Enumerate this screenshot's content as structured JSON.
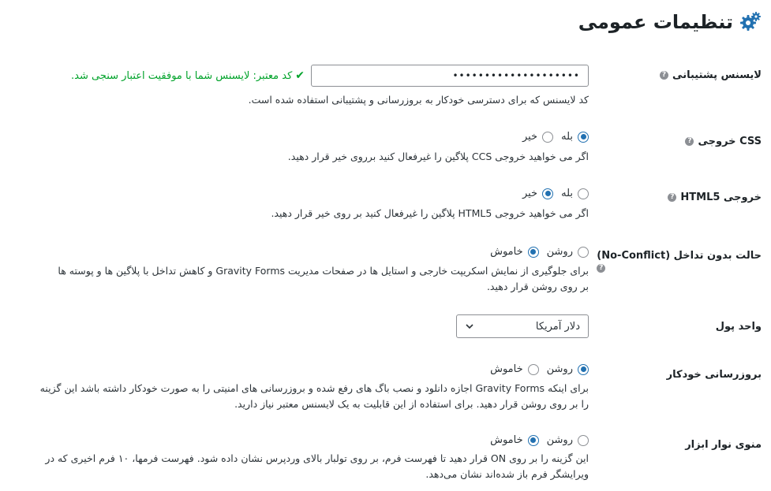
{
  "page": {
    "title": "تنظیمات عمومی",
    "title_icon": "gears-icon",
    "accent": "#2271b1"
  },
  "license": {
    "label": "لایسنس پشتیبانی",
    "value": "••••••••••••••••••••",
    "valid_message": "کد معتبر: لایسنس شما با موفقیت اعتبار سنجی شد.",
    "description": "کد لایسنس که برای دسترسی خودکار به بروزرسانی و پشتیبانی استفاده شده است."
  },
  "css_output": {
    "label": "CSS خروجی",
    "options": [
      "بله",
      "خیر"
    ],
    "selected": 0,
    "description": "اگر می خواهید خروجی CCS پلاگین را غیرفعال کنید برروی خیر قرار دهید."
  },
  "html5_output": {
    "label": "خروجی HTML5",
    "options": [
      "بله",
      "خیر"
    ],
    "selected": 1,
    "description": "اگر می خواهید خروجی HTML5 پلاگین را غیرفعال کنید بر روی خیر قرار دهید."
  },
  "no_conflict": {
    "label": "حالت بدون تداخل (No-Conflict)",
    "options": [
      "روشن",
      "خاموش"
    ],
    "selected": 1,
    "description_line1": "برای جلوگیری از نمایش اسکریپت خارجی و استایل ها در صفحات مدیریت Gravity Forms و کاهش تداخل با پلاگین ها و پوسته ها",
    "description_line2": "بر روی روشن قرار دهید."
  },
  "currency": {
    "label": "واحد پول",
    "selected": "دلار آمریکا"
  },
  "auto_update": {
    "label": "بروزرسانی خودکار",
    "options": [
      "روشن",
      "خاموش"
    ],
    "selected": 0,
    "description_line1": "برای اینکه Gravity Forms اجازه دانلود و نصب باگ های رفع شده و بروزرسانی های امنیتی را به صورت خودکار داشته باشد این گزینه",
    "description_line2": "را بر روی روشن قرار دهید. برای استفاده از این قابلیت به یک لایسنس معتبر نیاز دارید."
  },
  "toolbar_menu": {
    "label": "منوی نوار ابزار",
    "options": [
      "روشن",
      "خاموش"
    ],
    "selected": 1,
    "description_line1": "این گزینه را بر روی ON قرار دهید تا فهرست فرم، بر روی تولبار بالای وردپرس نشان داده شود. فهرست فرمها، ۱۰ فرم اخیری که در",
    "description_line2": "ویرایشگر فرم باز شده‌اند نشان می‌دهد."
  }
}
